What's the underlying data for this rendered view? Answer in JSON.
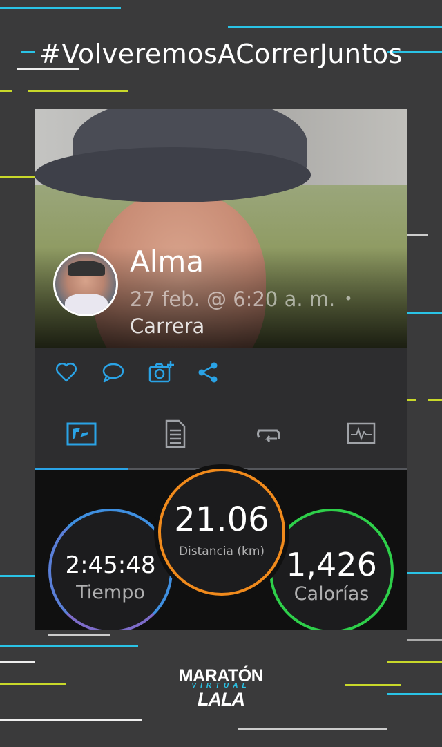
{
  "header": {
    "hashtag": "#VolveremosACorrerJuntos"
  },
  "post": {
    "name": "Alma",
    "date": "27 feb. @ 6:20 a. m.",
    "separator": "•",
    "activity_type": "Carrera"
  },
  "actions": [
    {
      "icon": "heart-icon"
    },
    {
      "icon": "comment-icon"
    },
    {
      "icon": "add-photo-icon"
    },
    {
      "icon": "share-icon"
    }
  ],
  "tabs": [
    {
      "icon": "summary-icon",
      "selected": true
    },
    {
      "icon": "details-icon",
      "selected": false
    },
    {
      "icon": "laps-icon",
      "selected": false
    },
    {
      "icon": "charts-icon",
      "selected": false
    }
  ],
  "stats": {
    "time": {
      "value": "2:45:48",
      "label": "Tiempo",
      "color": "#3f8fe0"
    },
    "distance": {
      "value": "21.06",
      "label": "Distancia (km)",
      "color": "#f08a1c"
    },
    "calories": {
      "value": "1,426",
      "label": "Calorías",
      "color": "#2ecf4a"
    }
  },
  "brand": {
    "line1": "MARATÓN",
    "line2": "VIRTUAL",
    "line3": "LALA"
  },
  "colors": {
    "accent": "#2aa3e6",
    "background": "#3a3a3b",
    "stripe_cyan": "#2ac3e6",
    "stripe_yellow": "#c8d82a"
  }
}
